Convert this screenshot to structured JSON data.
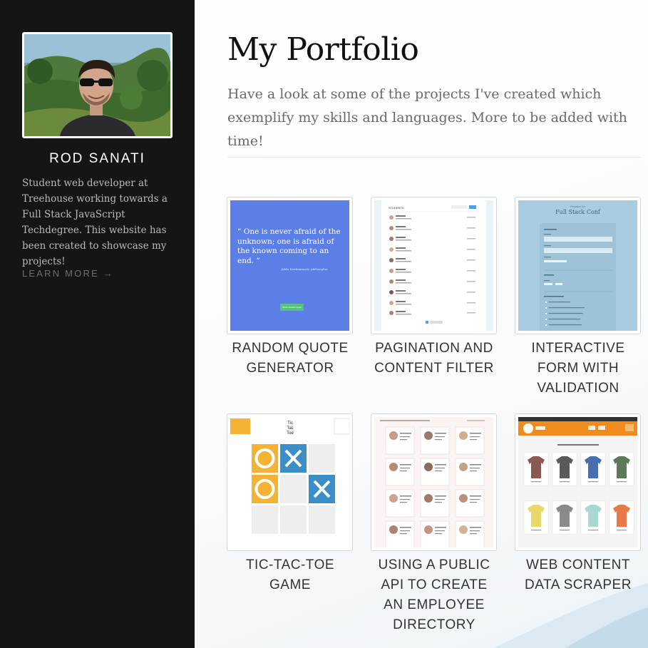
{
  "sidebar": {
    "avatar_alt": "Rod Sanati photo",
    "name": "ROD SANATI",
    "bio": "Student web developer at Treehouse working towards a Full Stack JavaScript Techdegree. This website has been created to showcase my projects!",
    "learn_more": "LEARN MORE →"
  },
  "main": {
    "title": "My Portfolio",
    "intro": "Have a look at some of the projects I've created which exemplify my skills and languages. More to be added with time!"
  },
  "projects": [
    {
      "caption": "RANDOM QUOTE GENERATOR",
      "thumb": {
        "quote": "“ One is never afraid of the unknown; one is afraid of the known coming to an end. ”",
        "attribution": "Jiddu Krishnamurti, philosopher",
        "button": "Show another quote",
        "bg_color": "#5b7fe6",
        "button_color": "#58c27a"
      }
    },
    {
      "caption": "PAGINATION AND CONTENT FILTER",
      "thumb": {
        "header": "STUDENTS"
      }
    },
    {
      "caption": "INTERACTIVE FORM WITH VALIDATION",
      "thumb": {
        "kicker": "Register for",
        "title": "Full Stack Conf"
      }
    },
    {
      "caption": "TIC-TAC-TOE GAME",
      "thumb": {
        "logo": "Tic Tac Toe",
        "o_color": "#f5b335",
        "x_color": "#3b8fc9"
      }
    },
    {
      "caption": "USING A PUBLIC API TO CREATE AN EMPLOYEE DIRECTORY",
      "thumb": {
        "header": "AWESOME STARTUP EMPLOYEE DIRECTORY"
      }
    },
    {
      "caption": "WEB CONTENT DATA SCRAPER",
      "thumb": {
        "header": "Shirts For Mike",
        "heading": "Mike's Full Catalog of Shirts",
        "accent": "#f08c1c"
      }
    }
  ],
  "colors": {
    "sidebar_bg": "#151515",
    "title": "#111111",
    "intro": "#6a6a6a",
    "caption": "#333333"
  }
}
